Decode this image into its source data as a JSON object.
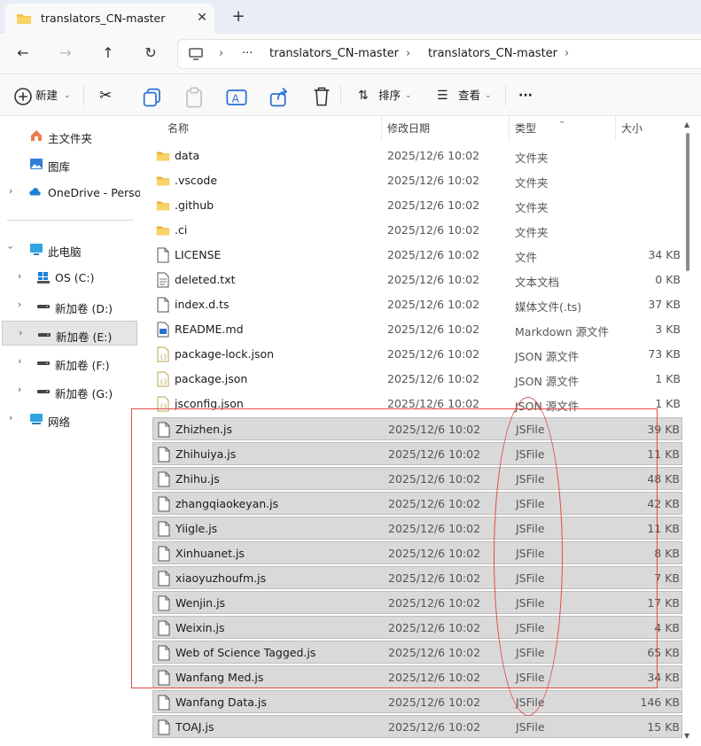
{
  "window": {
    "tab_title": "translators_CN-master",
    "close_glyph": "✕",
    "add_glyph": "+"
  },
  "address_bar": {
    "ellipsis": "···",
    "crumbs": [
      "translators_CN-master",
      "translators_CN-master"
    ]
  },
  "toolbar": {
    "new_label": "新建",
    "sort_label": "排序",
    "view_label": "查看",
    "more_label": "···"
  },
  "sidebar": {
    "items": [
      {
        "label": "主文件夹",
        "icon": "home-icon"
      },
      {
        "label": "图库",
        "icon": "gallery-icon"
      },
      {
        "label": "OneDrive - Perso",
        "icon": "onedrive-icon"
      },
      {
        "label": "此电脑",
        "icon": "this-pc-icon"
      },
      {
        "label": "OS (C:)",
        "icon": "windows-drive-icon"
      },
      {
        "label": "新加卷 (D:)",
        "icon": "drive-icon"
      },
      {
        "label": "新加卷 (E:)",
        "icon": "drive-icon"
      },
      {
        "label": "新加卷 (F:)",
        "icon": "drive-icon"
      },
      {
        "label": "新加卷 (G:)",
        "icon": "drive-icon"
      },
      {
        "label": "网络",
        "icon": "network-icon"
      }
    ]
  },
  "columns": {
    "name": "名称",
    "date": "修改日期",
    "type": "类型",
    "size": "大小"
  },
  "files": [
    {
      "name": "data",
      "date": "2025/12/6 10:02",
      "type": "文件夹",
      "size": "",
      "kind": "folder"
    },
    {
      "name": ".vscode",
      "date": "2025/12/6 10:02",
      "type": "文件夹",
      "size": "",
      "kind": "folder"
    },
    {
      "name": ".github",
      "date": "2025/12/6 10:02",
      "type": "文件夹",
      "size": "",
      "kind": "folder"
    },
    {
      "name": ".ci",
      "date": "2025/12/6 10:02",
      "type": "文件夹",
      "size": "",
      "kind": "folder"
    },
    {
      "name": "LICENSE",
      "date": "2025/12/6 10:02",
      "type": "文件",
      "size": "34 KB",
      "kind": "file"
    },
    {
      "name": "deleted.txt",
      "date": "2025/12/6 10:02",
      "type": "文本文档",
      "size": "0 KB",
      "kind": "text"
    },
    {
      "name": "index.d.ts",
      "date": "2025/12/6 10:02",
      "type": "媒体文件(.ts)",
      "size": "37 KB",
      "kind": "file"
    },
    {
      "name": "README.md",
      "date": "2025/12/6 10:02",
      "type": "Markdown 源文件",
      "size": "3 KB",
      "kind": "markdown"
    },
    {
      "name": "package-lock.json",
      "date": "2025/12/6 10:02",
      "type": "JSON 源文件",
      "size": "73 KB",
      "kind": "json"
    },
    {
      "name": "package.json",
      "date": "2025/12/6 10:02",
      "type": "JSON 源文件",
      "size": "1 KB",
      "kind": "json"
    },
    {
      "name": "jsconfig.json",
      "date": "2025/12/6 10:02",
      "type": "JSON 源文件",
      "size": "1 KB",
      "kind": "json"
    },
    {
      "name": "Zhizhen.js",
      "date": "2025/12/6 10:02",
      "type": "JSFile",
      "size": "39 KB",
      "kind": "file",
      "selected": true
    },
    {
      "name": "Zhihuiya.js",
      "date": "2025/12/6 10:02",
      "type": "JSFile",
      "size": "11 KB",
      "kind": "file",
      "selected": true
    },
    {
      "name": "Zhihu.js",
      "date": "2025/12/6 10:02",
      "type": "JSFile",
      "size": "48 KB",
      "kind": "file",
      "selected": true
    },
    {
      "name": "zhangqiaokeyan.js",
      "date": "2025/12/6 10:02",
      "type": "JSFile",
      "size": "42 KB",
      "kind": "file",
      "selected": true
    },
    {
      "name": "Yiigle.js",
      "date": "2025/12/6 10:02",
      "type": "JSFile",
      "size": "11 KB",
      "kind": "file",
      "selected": true
    },
    {
      "name": "Xinhuanet.js",
      "date": "2025/12/6 10:02",
      "type": "JSFile",
      "size": "8 KB",
      "kind": "file",
      "selected": true
    },
    {
      "name": "xiaoyuzhoufm.js",
      "date": "2025/12/6 10:02",
      "type": "JSFile",
      "size": "7 KB",
      "kind": "file",
      "selected": true
    },
    {
      "name": "Wenjin.js",
      "date": "2025/12/6 10:02",
      "type": "JSFile",
      "size": "17 KB",
      "kind": "file",
      "selected": true
    },
    {
      "name": "Weixin.js",
      "date": "2025/12/6 10:02",
      "type": "JSFile",
      "size": "4 KB",
      "kind": "file",
      "selected": true
    },
    {
      "name": "Web of Science Tagged.js",
      "date": "2025/12/6 10:02",
      "type": "JSFile",
      "size": "65 KB",
      "kind": "file",
      "selected": true
    },
    {
      "name": "Wanfang Med.js",
      "date": "2025/12/6 10:02",
      "type": "JSFile",
      "size": "34 KB",
      "kind": "file",
      "selected": true
    },
    {
      "name": "Wanfang Data.js",
      "date": "2025/12/6 10:02",
      "type": "JSFile",
      "size": "146 KB",
      "kind": "file",
      "selected": true
    },
    {
      "name": "TOAJ.js",
      "date": "2025/12/6 10:02",
      "type": "JSFile",
      "size": "15 KB",
      "kind": "file",
      "selected": true
    }
  ],
  "colors": {
    "annotation": "#e24a4a",
    "folder": "#f4c242",
    "selection": "#d9d9d9"
  }
}
